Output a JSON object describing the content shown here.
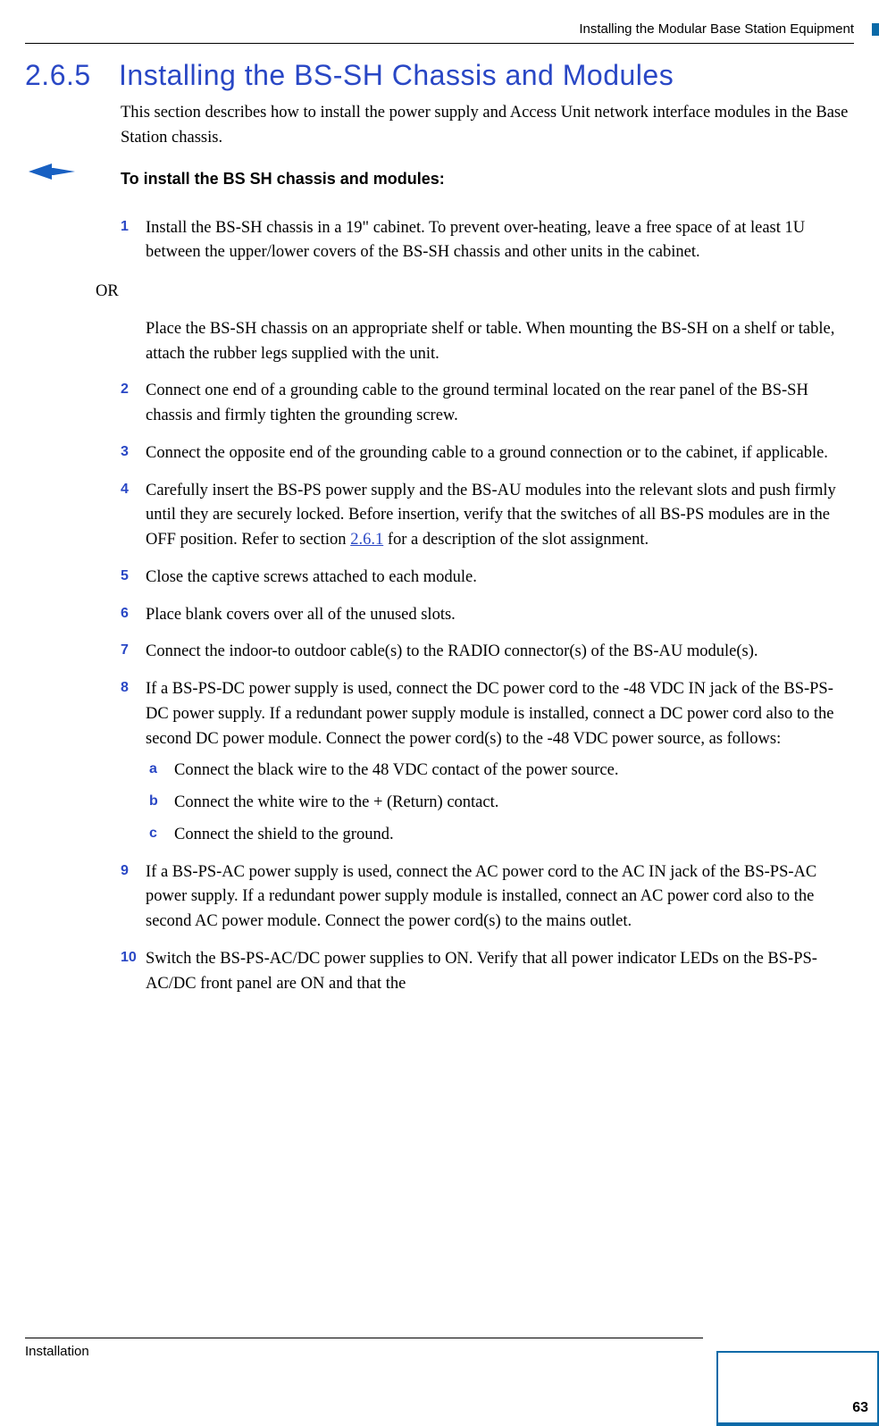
{
  "header": {
    "running_title": "Installing the Modular Base Station Equipment"
  },
  "section": {
    "number": "2.6.5",
    "title": "Installing the BS-SH Chassis and Modules"
  },
  "intro": "This section describes how to install the power supply and Access Unit network interface modules in the Base Station chassis.",
  "lead": "To install the BS SH chassis and modules:",
  "steps": {
    "s1": {
      "n": "1",
      "text": "Install the BS-SH chassis in a 19\" cabinet. To prevent over-heating, leave a free space of at least 1U between the upper/lower covers of the BS-SH chassis and other units in the cabinet."
    },
    "or": "OR",
    "alt": "Place the BS-SH chassis on an appropriate shelf or table. When mounting the BS-SH on a shelf or table, attach the rubber legs supplied with the unit.",
    "s2": {
      "n": "2",
      "text": "Connect one end of a grounding cable to the ground terminal located on the rear panel of the BS-SH chassis and firmly tighten the grounding screw."
    },
    "s3": {
      "n": "3",
      "text": "Connect the opposite end of the grounding cable to a ground connection or to the cabinet, if applicable."
    },
    "s4": {
      "n": "4",
      "pre": "Carefully insert the BS-PS power supply and the BS-AU modules into the relevant slots and push firmly until they are securely locked. Before insertion, verify that the switches of all BS-PS modules are in the OFF position. Refer to section ",
      "link": "2.6.1",
      "post": " for a description of the slot assignment."
    },
    "s5": {
      "n": "5",
      "text": "Close the captive screws attached to each module."
    },
    "s6": {
      "n": "6",
      "text": "Place blank covers over all of the unused slots."
    },
    "s7": {
      "n": "7",
      "text": "Connect the indoor-to outdoor cable(s) to the RADIO connector(s) of the BS-AU module(s)."
    },
    "s8": {
      "n": "8",
      "text": "If a BS-PS-DC power supply is used, connect the DC power cord to the -48 VDC IN jack of the BS-PS-DC power supply. If a redundant power supply module is installed, connect a DC power cord also to the second DC power module. Connect the power cord(s) to the  -48 VDC power source, as follows:"
    },
    "sa": {
      "n": "a",
      "text": "Connect the black wire to the  48 VDC contact of the power source."
    },
    "sb": {
      "n": "b",
      "text": "Connect the white wire to the + (Return) contact."
    },
    "sc": {
      "n": "c",
      "text": "Connect the shield to the ground."
    },
    "s9": {
      "n": "9",
      "text": "If a BS-PS-AC power supply is used, connect the AC power cord to the AC IN jack of the BS-PS-AC power supply. If a redundant power supply module is installed, connect an AC power cord also to the second AC power module. Connect the power cord(s) to the mains outlet."
    },
    "s10": {
      "n": "10",
      "text": "Switch the BS-PS-AC/DC power supplies to ON. Verify that all power indicator LEDs on the BS-PS-AC/DC front panel are ON and that the"
    }
  },
  "footer": {
    "section": "Installation",
    "page": "63"
  }
}
